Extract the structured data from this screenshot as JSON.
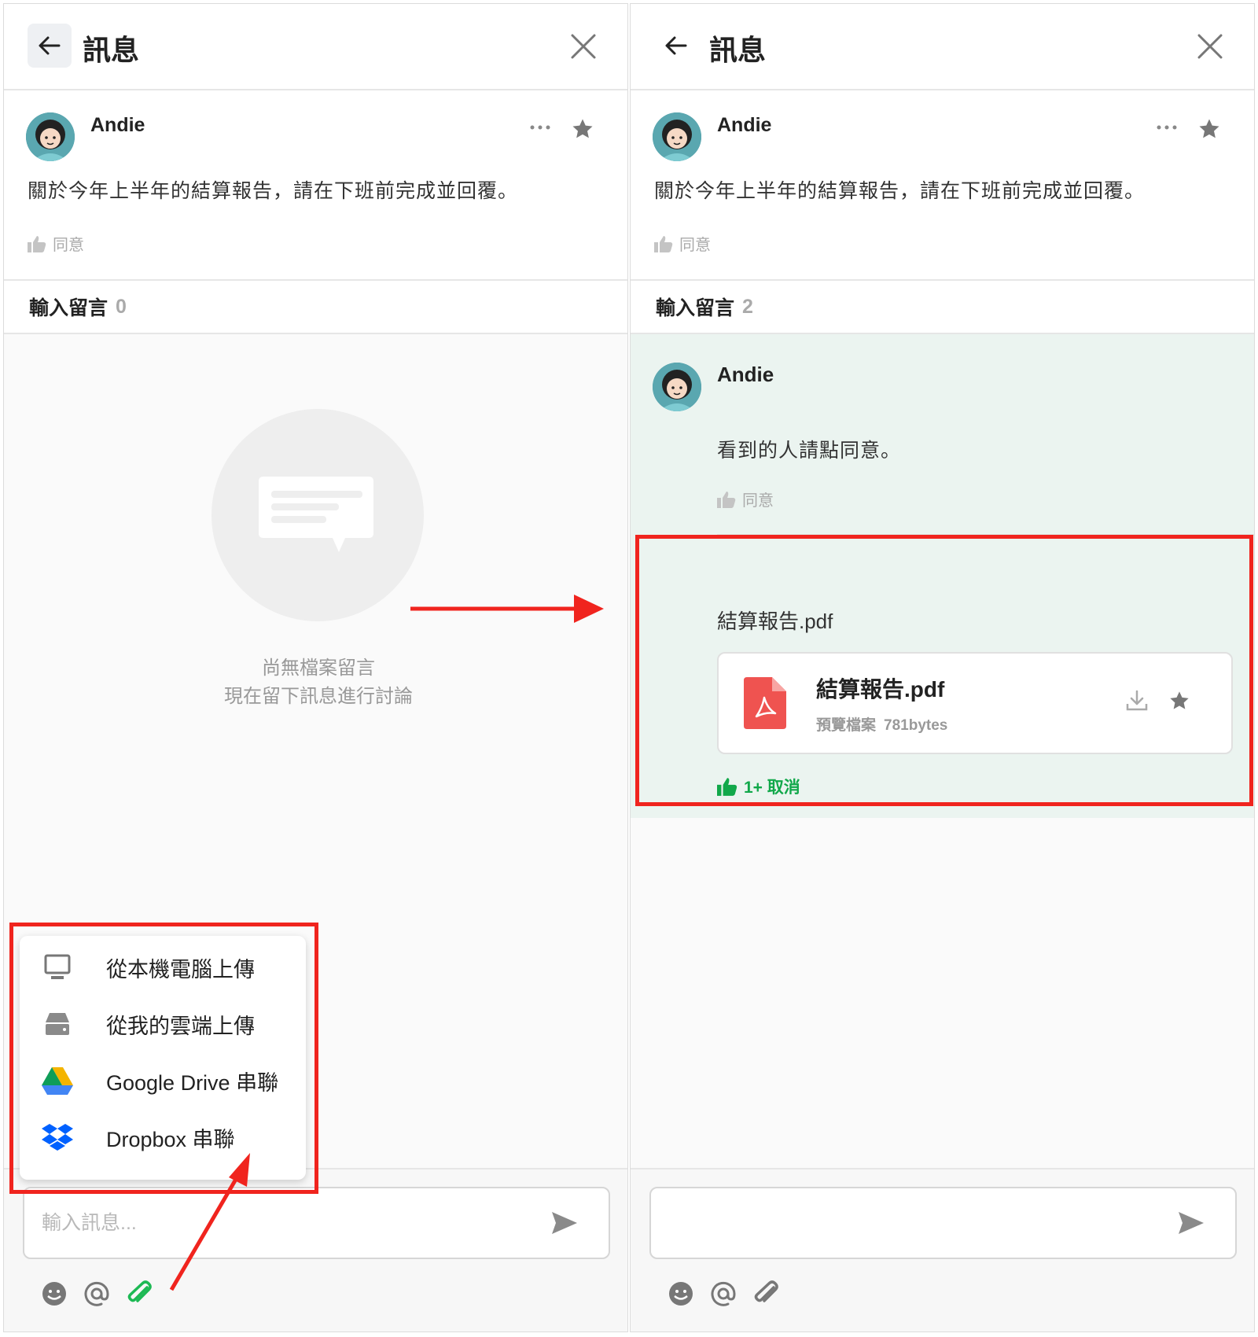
{
  "left": {
    "header_title": "訊息",
    "post": {
      "author": "Andie",
      "text": "關於今年上半年的結算報告，請在下班前完成並回覆。",
      "like_label": "同意"
    },
    "comments": {
      "label": "輸入留言",
      "count": "0"
    },
    "empty": {
      "line1": "尚無檔案留言",
      "line2": "現在留下訊息進行討論"
    },
    "attach_menu": [
      {
        "label": "從本機電腦上傳",
        "icon": "monitor-icon"
      },
      {
        "label": "從我的雲端上傳",
        "icon": "drive-icon"
      },
      {
        "label": "Google Drive 串聯",
        "icon": "google-drive-icon"
      },
      {
        "label": "Dropbox 串聯",
        "icon": "dropbox-icon"
      }
    ],
    "composer": {
      "placeholder": "輸入訊息..."
    }
  },
  "right": {
    "header_title": "訊息",
    "post": {
      "author": "Andie",
      "text": "關於今年上半年的結算報告，請在下班前完成並回覆。",
      "like_label": "同意"
    },
    "comments": {
      "label": "輸入留言",
      "count": "2"
    },
    "comment1": {
      "author": "Andie",
      "text": "看到的人請點同意。",
      "like_label": "同意"
    },
    "comment2": {
      "file_title": "結算報告.pdf",
      "file_name": "結算報告.pdf",
      "preview_label": "預覽檔案",
      "file_size": "781bytes",
      "liked_text": "1+ 取消"
    },
    "composer": {
      "placeholder": ""
    }
  },
  "colors": {
    "accent_red": "#f0241e",
    "like_green": "#11a84a",
    "attach_green": "#1db954",
    "comment_bg": "#ebf4f0",
    "pdf_red": "#ef5350"
  }
}
